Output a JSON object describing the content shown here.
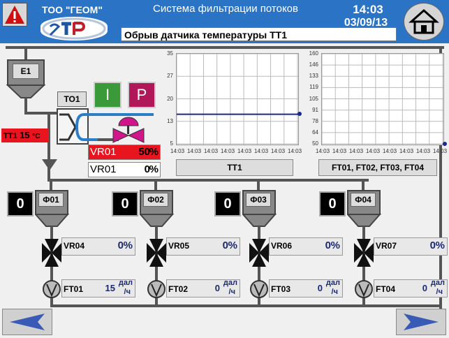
{
  "header": {
    "company": "ТОО \"ГЕОМ\"",
    "title": "Система фильтрации потоков",
    "time": "14:03",
    "date": "03/09/13",
    "message": "Обрыв датчика температуры ТТ1",
    "alarm_icon": "warning-icon",
    "home_icon": "home-icon"
  },
  "tank": {
    "label": "E1"
  },
  "heat_exchanger": {
    "label": "ТО1"
  },
  "buttons": {
    "i_label": "I",
    "p_label": "P",
    "i_color": "#3a9a3a",
    "p_color": "#b0185a"
  },
  "tt1": {
    "label": "ТТ1",
    "value": "15",
    "unit": "°C"
  },
  "vr01_main": {
    "label": "VR01",
    "value": "50",
    "unit": "%"
  },
  "vr01_sub": {
    "label": "VR01",
    "value": "0",
    "unit": "%"
  },
  "chart1": {
    "yticks": [
      "35",
      "27",
      "20",
      "13",
      "5"
    ],
    "xticks": [
      "14:03",
      "14:03",
      "14:03",
      "14:03",
      "14:03",
      "14:03",
      "14:03",
      "14:03"
    ],
    "label": "TT1"
  },
  "chart2": {
    "yticks": [
      "160",
      "146",
      "133",
      "119",
      "105",
      "91",
      "78",
      "64",
      "50"
    ],
    "xticks": [
      "14:03",
      "14:03",
      "14:03",
      "14:03",
      "14:03",
      "14:03",
      "14:03",
      "14:03"
    ],
    "label": "FT01, FT02, FT03, FT04"
  },
  "chart_data": [
    {
      "type": "line",
      "ylim": [
        5,
        35
      ],
      "series": [
        {
          "values": [
            15,
            15,
            15,
            15,
            15,
            15,
            15,
            15
          ]
        }
      ],
      "x": [
        "14:03",
        "14:03",
        "14:03",
        "14:03",
        "14:03",
        "14:03",
        "14:03",
        "14:03"
      ],
      "grid": true,
      "label": "TT1"
    },
    {
      "type": "line",
      "ylim": [
        50,
        160
      ],
      "series": [],
      "x": [
        "14:03",
        "14:03",
        "14:03",
        "14:03",
        "14:03",
        "14:03",
        "14:03",
        "14:03"
      ],
      "grid": true,
      "label": "FT01, FT02, FT03, FT04"
    }
  ],
  "filters": [
    {
      "label": "Ф01",
      "count": "0",
      "valve": "VR04",
      "valve_pct": "0",
      "valve_unit": "%",
      "ft": "FT01",
      "ft_val": "15",
      "ft_unit_top": "дал",
      "ft_unit_bot": "/ч"
    },
    {
      "label": "Ф02",
      "count": "0",
      "valve": "VR05",
      "valve_pct": "0",
      "valve_unit": "%",
      "ft": "FT02",
      "ft_val": "0",
      "ft_unit_top": "дал",
      "ft_unit_bot": "/ч"
    },
    {
      "label": "Ф03",
      "count": "0",
      "valve": "VR06",
      "valve_pct": "0",
      "valve_unit": "%",
      "ft": "FT03",
      "ft_val": "0",
      "ft_unit_top": "дал",
      "ft_unit_bot": "/ч"
    },
    {
      "label": "Ф04",
      "count": "0",
      "valve": "VR07",
      "valve_pct": "0",
      "valve_unit": "%",
      "ft": "FT04",
      "ft_val": "0",
      "ft_unit_top": "дал",
      "ft_unit_bot": "/ч"
    }
  ],
  "nav": {
    "prev_icon": "arrow-left-icon",
    "next_icon": "arrow-right-icon"
  }
}
